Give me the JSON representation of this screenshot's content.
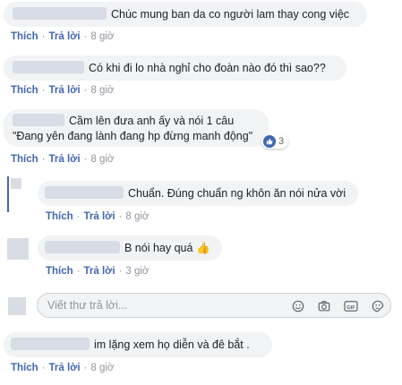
{
  "comments": [
    {
      "text": "Chúc mung ban da co người lam thay cong việc",
      "like": "Thích",
      "reply": "Trả lời",
      "time": "8 giờ"
    },
    {
      "text": "Có khi đi lo nhà nghỉ cho đoàn nào đó thì sao??",
      "like": "Thích",
      "reply": "Trả lời",
      "time": "8 giờ"
    },
    {
      "line1": "Cầm lên đưa anh ấy và nói 1 câu",
      "line2": "\"Đang yên đang lành đang hp đừng manh động\"",
      "reaction_count": "3",
      "like": "Thích",
      "reply": "Trả lời",
      "time": "8 giờ"
    },
    {
      "text": "Chuẩn. Đúng chuẩn ng khôn ăn nói nửa vời",
      "like": "Thích",
      "reply": "Trả lời",
      "time": "8 giờ"
    },
    {
      "text": "B nói hay quá",
      "emoji": "👍",
      "like": "Thích",
      "reply": "Trả lời",
      "time": "3 giờ"
    },
    {
      "text": "im lặng xem họ diễn và đê bắt .",
      "like": "Thích",
      "reply": "Trả lời",
      "time": "8 giờ"
    }
  ],
  "reply_box": {
    "placeholder": "Viết thư trả lời..."
  },
  "icons": [
    "emoji-icon",
    "camera-icon",
    "gif-icon",
    "sticker-icon",
    "like-reaction-icon"
  ],
  "colors": {
    "accent": "#4267b2",
    "bubble": "#f2f3f5",
    "meta": "#90949c"
  }
}
